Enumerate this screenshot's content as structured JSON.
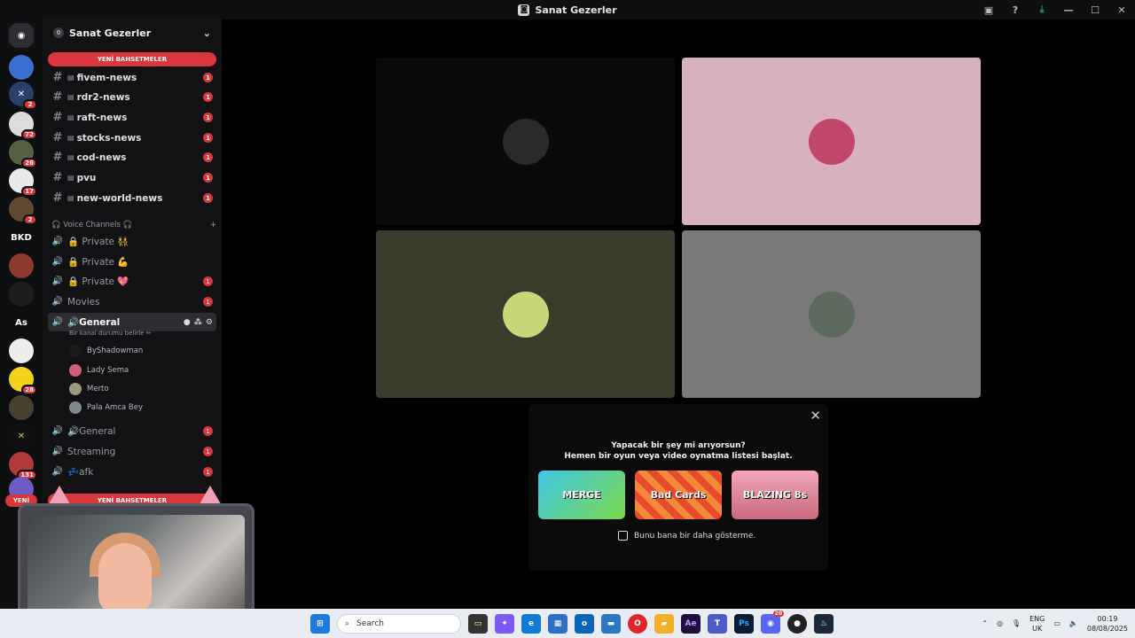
{
  "window": {
    "title": "Sanat Gezerler"
  },
  "server": {
    "name": "Sanat Gezerler",
    "level": "0"
  },
  "rail": {
    "items": [
      {
        "label": "",
        "badge": ""
      },
      {
        "label": "",
        "badge": "2"
      },
      {
        "label": "",
        "badge": "72"
      },
      {
        "label": "",
        "badge": "26"
      },
      {
        "label": "",
        "badge": "17"
      },
      {
        "label": "",
        "badge": "2"
      },
      {
        "label": "BKD",
        "badge": ""
      },
      {
        "label": "",
        "badge": ""
      },
      {
        "label": "",
        "badge": ""
      },
      {
        "label": "As",
        "badge": ""
      },
      {
        "label": "",
        "badge": ""
      },
      {
        "label": "",
        "badge": "28"
      },
      {
        "label": "",
        "badge": ""
      },
      {
        "label": "",
        "badge": ""
      },
      {
        "label": "",
        "badge": "131"
      },
      {
        "label": "YENİ",
        "badge": ""
      }
    ]
  },
  "mentions_label": "YENİ BAHSETMELER",
  "mentions_label_bottom": "YENİ BAHSETMELER",
  "text_channels": [
    {
      "name": "fivem-news",
      "badge": "1"
    },
    {
      "name": "rdr2-news",
      "badge": "1"
    },
    {
      "name": "raft-news",
      "badge": "1"
    },
    {
      "name": "stocks-news",
      "badge": "1"
    },
    {
      "name": "cod-news",
      "badge": "1"
    },
    {
      "name": "pvu",
      "badge": "1"
    },
    {
      "name": "new-world-news",
      "badge": "1"
    }
  ],
  "voice_category": "🎧 Voice Channels 🎧",
  "voice_channels": [
    {
      "name": "🔒 Private 👯",
      "badge": ""
    },
    {
      "name": "🔒 Private 💪",
      "badge": ""
    },
    {
      "name": "🔒 Private 💖",
      "badge": "1"
    },
    {
      "name": "Movies",
      "badge": "1"
    },
    {
      "name": "🔊General",
      "badge": ""
    },
    {
      "name": "🔊General",
      "badge": "1"
    },
    {
      "name": "Streaming",
      "badge": "1"
    },
    {
      "name": "💤afk",
      "badge": "1"
    }
  ],
  "active_status": "Bir kanal durumu belirle ✏",
  "members": [
    {
      "name": "ByShadowman",
      "color": "#1b1b1b"
    },
    {
      "name": "Lady Sema",
      "color": "#d0607a"
    },
    {
      "name": "Merto",
      "color": "#9a9a7a"
    },
    {
      "name": "Pala Amca Bey",
      "color": "#808890"
    }
  ],
  "tiles": [
    {
      "bg": "#0a0a0a",
      "avatar": "#2a2a2a"
    },
    {
      "bg": "#d7b1bf",
      "avatar": "#c0486a"
    },
    {
      "bg": "#3a3b2c",
      "avatar": "#c7d87a"
    },
    {
      "bg": "#7a7a7a",
      "avatar": "#5b6a5c"
    }
  ],
  "popup": {
    "line1": "Yapacak bir şey mi arıyorsun?",
    "line2": "Hemen bir oyun veya video oynatma listesi başlat.",
    "games": [
      "MERGE",
      "Bad Cards",
      "BLAZING 8s"
    ],
    "dont_show": "Bunu bana bir daha gösterme."
  },
  "taskbar": {
    "search_placeholder": "Search",
    "lang_top": "ENG",
    "lang_bottom": "UK",
    "time": "00:19",
    "date": "08/08/2025",
    "discord_badge": "20"
  }
}
